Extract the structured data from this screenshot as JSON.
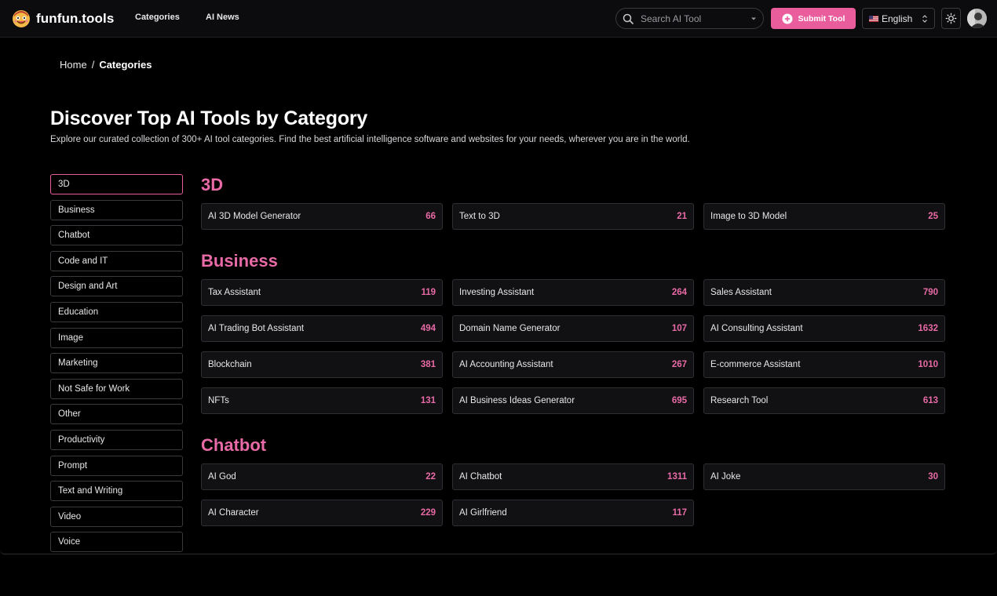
{
  "header": {
    "brand": "funfun.tools",
    "nav": {
      "categories": "Categories",
      "ai_news": "AI News"
    },
    "search_placeholder": "Search AI Tool",
    "submit_label": "Submit Tool",
    "language": "English",
    "icons": {
      "logo": "emoji-face-logo",
      "search": "search-icon",
      "plus": "plus-circle-icon",
      "flag": "us-flag-icon",
      "theme": "sun-icon",
      "avatar": "user-avatar"
    }
  },
  "breadcrumb": {
    "home": "Home",
    "separator": "/",
    "current": "Categories"
  },
  "page": {
    "title": "Discover Top AI Tools by Category",
    "subtitle": "Explore our curated collection of 300+ AI tool categories. Find the best artificial intelligence software and websites for your needs, wherever you are in the world."
  },
  "sidebar": {
    "items": [
      {
        "label": "3D",
        "active": true
      },
      {
        "label": "Business"
      },
      {
        "label": "Chatbot"
      },
      {
        "label": "Code and IT"
      },
      {
        "label": "Design and Art"
      },
      {
        "label": "Education"
      },
      {
        "label": "Image"
      },
      {
        "label": "Marketing"
      },
      {
        "label": "Not Safe for Work"
      },
      {
        "label": "Other"
      },
      {
        "label": "Productivity"
      },
      {
        "label": "Prompt"
      },
      {
        "label": "Text and Writing"
      },
      {
        "label": "Video"
      },
      {
        "label": "Voice"
      }
    ]
  },
  "sections": [
    {
      "title": "3D",
      "cards": [
        {
          "name": "AI 3D Model Generator",
          "count": "66"
        },
        {
          "name": "Text to 3D",
          "count": "21"
        },
        {
          "name": "Image to 3D Model",
          "count": "25"
        }
      ]
    },
    {
      "title": "Business",
      "cards": [
        {
          "name": "Tax Assistant",
          "count": "119"
        },
        {
          "name": "Investing Assistant",
          "count": "264"
        },
        {
          "name": "Sales Assistant",
          "count": "790"
        },
        {
          "name": "AI Trading Bot Assistant",
          "count": "494"
        },
        {
          "name": "Domain Name Generator",
          "count": "107"
        },
        {
          "name": "AI Consulting Assistant",
          "count": "1632"
        },
        {
          "name": "Blockchain",
          "count": "381"
        },
        {
          "name": "AI Accounting Assistant",
          "count": "267"
        },
        {
          "name": "E-commerce Assistant",
          "count": "1010"
        },
        {
          "name": "NFTs",
          "count": "131"
        },
        {
          "name": "AI Business Ideas Generator",
          "count": "695"
        },
        {
          "name": "Research Tool",
          "count": "613"
        }
      ]
    },
    {
      "title": "Chatbot",
      "cards": [
        {
          "name": "AI God",
          "count": "22"
        },
        {
          "name": "AI Chatbot",
          "count": "1311"
        },
        {
          "name": "AI Joke",
          "count": "30"
        },
        {
          "name": "AI Character",
          "count": "229"
        },
        {
          "name": "AI Girlfriend",
          "count": "117"
        }
      ]
    }
  ],
  "colors": {
    "accent": "#e95d9d",
    "accent_text": "#e86aa6",
    "background": "#000000",
    "card_bg": "#111113",
    "border": "#3a3a3f"
  }
}
